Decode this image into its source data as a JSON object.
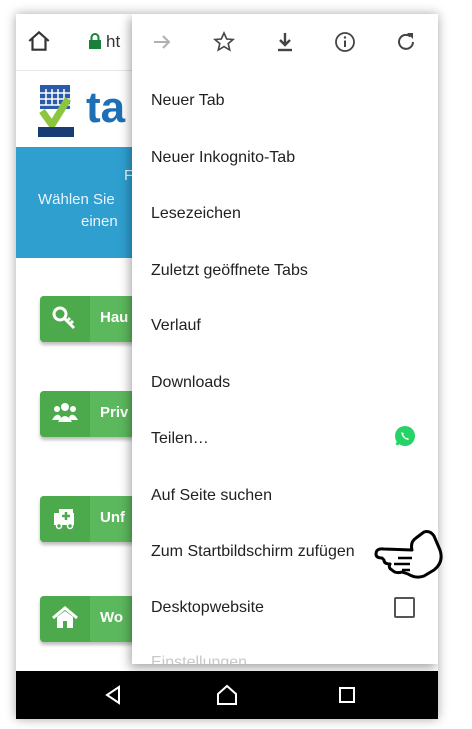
{
  "address_bar": {
    "url_partial": "ht",
    "home_icon": "home-icon",
    "lock_icon": "lock-icon"
  },
  "page": {
    "logo_text": "ta",
    "banner_lines": [
      "F",
      "Wählen Sie",
      "einen"
    ],
    "buttons": [
      {
        "label": "Hau",
        "icon": "key-icon"
      },
      {
        "label": "Priv",
        "icon": "people-icon"
      },
      {
        "label": "Unf",
        "icon": "ambulance-icon"
      },
      {
        "label": "Wo",
        "icon": "house-icon"
      }
    ]
  },
  "menu": {
    "toolbar_icons": [
      "forward-icon",
      "star-icon",
      "download-icon",
      "info-icon",
      "reload-icon"
    ],
    "items": [
      "Neuer Tab",
      "Neuer Inkognito-Tab",
      "Lesezeichen",
      "Zuletzt geöffnete Tabs",
      "Verlauf",
      "Downloads",
      "Teilen…",
      "Auf Seite suchen",
      "Zum Startbildschirm zufügen",
      "Desktopwebsite",
      "Einstellungen"
    ],
    "desktop_site_checked": false,
    "share_app_icon": "whatsapp-icon"
  },
  "nav_bar": {
    "icons": [
      "back-icon",
      "home-icon",
      "recents-icon"
    ]
  },
  "colors": {
    "banner": "#2f9fcf",
    "button_green": "#5cb85c",
    "whatsapp_green": "#25d366"
  }
}
